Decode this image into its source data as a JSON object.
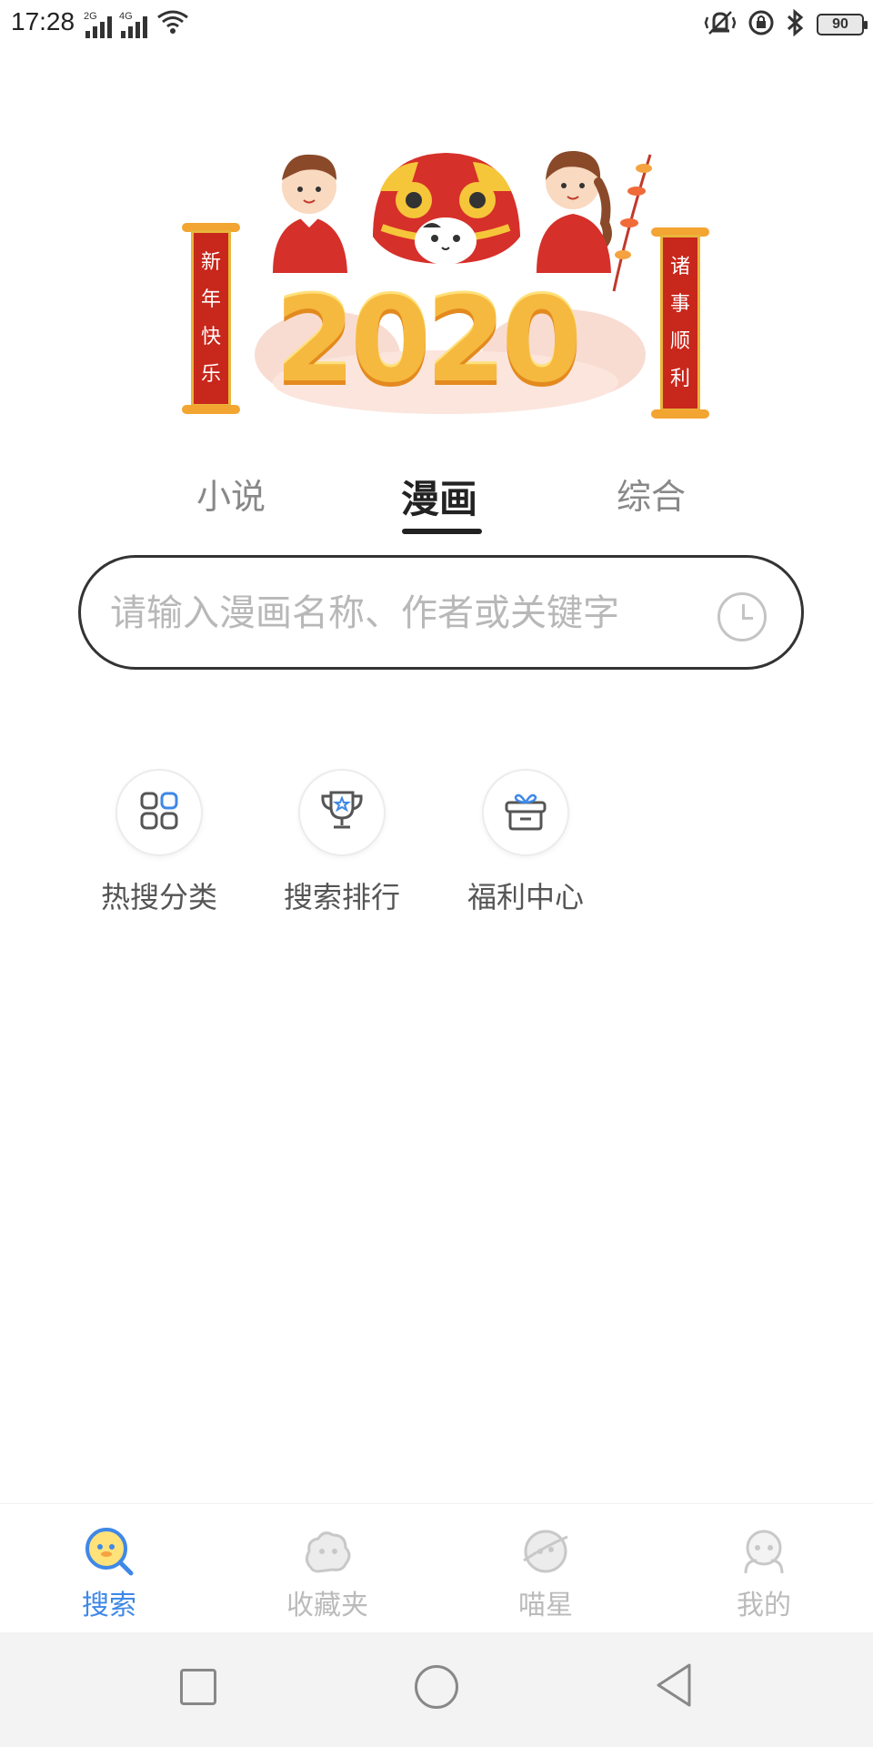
{
  "status_bar": {
    "time": "17:28",
    "signal_1_tag": "2G",
    "signal_2_tag": "4G",
    "battery": "90"
  },
  "banner": {
    "left_couplet": [
      "新",
      "年",
      "快",
      "乐"
    ],
    "right_couplet": [
      "诸",
      "事",
      "顺",
      "利"
    ],
    "year": "2020"
  },
  "tabs": [
    {
      "label": "小说",
      "active": false
    },
    {
      "label": "漫画",
      "active": true
    },
    {
      "label": "综合",
      "active": false
    }
  ],
  "search": {
    "placeholder": "请输入漫画名称、作者或关键字",
    "value": ""
  },
  "quick_actions": [
    {
      "label": "热搜分类",
      "icon": "grid-icon"
    },
    {
      "label": "搜索排行",
      "icon": "trophy-icon"
    },
    {
      "label": "福利中心",
      "icon": "gift-icon"
    }
  ],
  "bottom_nav": [
    {
      "label": "搜索",
      "icon": "search-face-icon",
      "active": true
    },
    {
      "label": "收藏夹",
      "icon": "cloud-face-icon",
      "active": false
    },
    {
      "label": "喵星",
      "icon": "planet-icon",
      "active": false
    },
    {
      "label": "我的",
      "icon": "user-face-icon",
      "active": false
    }
  ],
  "colors": {
    "accent": "#3f88e6",
    "inactive": "#bbbbbb",
    "couplet_red": "#c8271b",
    "year_gold": "#f6b93f"
  }
}
